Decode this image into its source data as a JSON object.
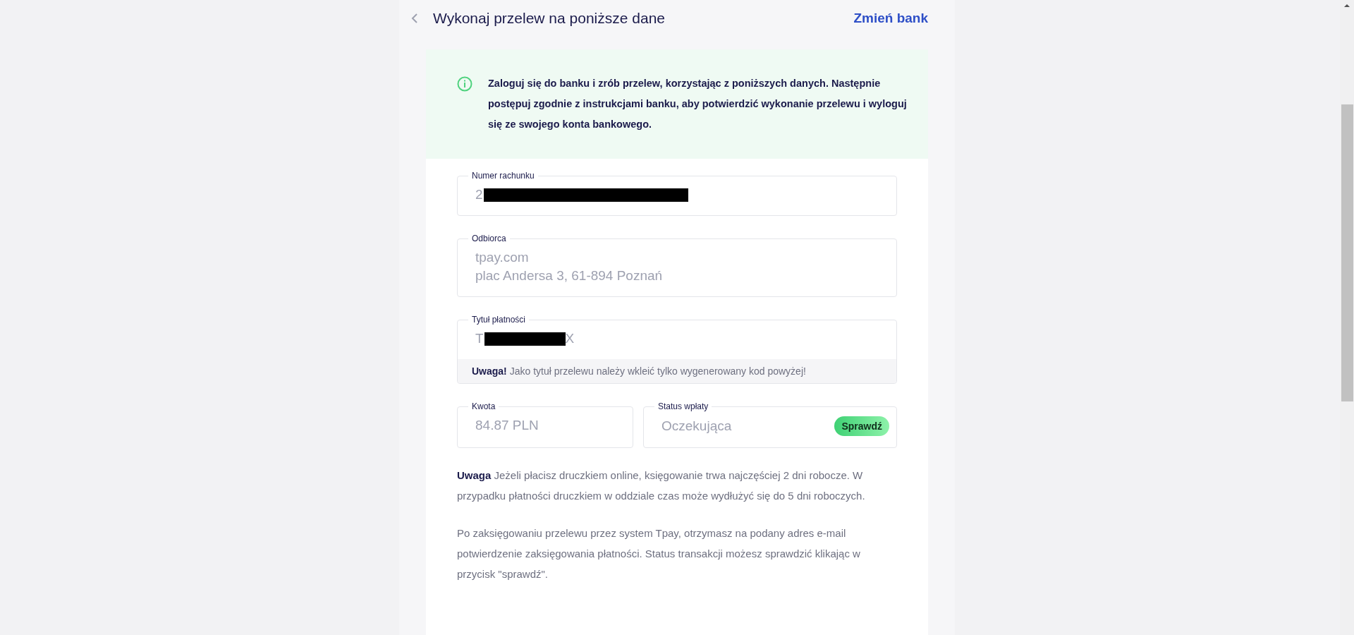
{
  "header": {
    "title": "Wykonaj przelew na poniższe dane",
    "change_bank": "Zmień bank"
  },
  "info": {
    "text": "Zaloguj się do banku i zrób przelew, korzystając z poniższych danych. Następnie postępuj zgodnie z instrukcjami banku, aby potwierdzić wykonanie przelewu i wyloguj się ze swojego konta bankowego."
  },
  "fields": [
    {
      "kind": "redacted",
      "label": "Numer rachunku",
      "value_prefix": "2"
    },
    {
      "kind": "multiline",
      "label": "Odbiorca",
      "lines": [
        "tpay.com",
        "plac Andersa 3, 61-894 Poznań"
      ]
    },
    {
      "kind": "redacted",
      "label": "Tytuł płatności",
      "value_prefix": "T",
      "value_suffix": "X",
      "note": "**Uwaga!** Jako tytuł przelewu należy wkleić tylko wygenerowany kod powyżej!"
    }
  ],
  "amount": {
    "label": "Kwota",
    "value": "84.87 PLN"
  },
  "status": {
    "label": "Status wpłaty",
    "value": "Oczekująca",
    "button": "Sprawdź"
  },
  "paragraphs": [
    "**Uwaga** Jeżeli płacisz druczkiem online, księgowanie trwa najczęściej 2 dni robocze. W przypadku płatności druczkiem w oddziale czas może wydłużyć się do 5 dni roboczych.",
    "Po zaksięgowaniu przelewu przez system Tpay, otrzymasz na podany adres e-mail potwierdzenie zaksięgowania płatności. Status transakcji możesz sprawdzić klikając w przycisk \"sprawdź\"."
  ]
}
